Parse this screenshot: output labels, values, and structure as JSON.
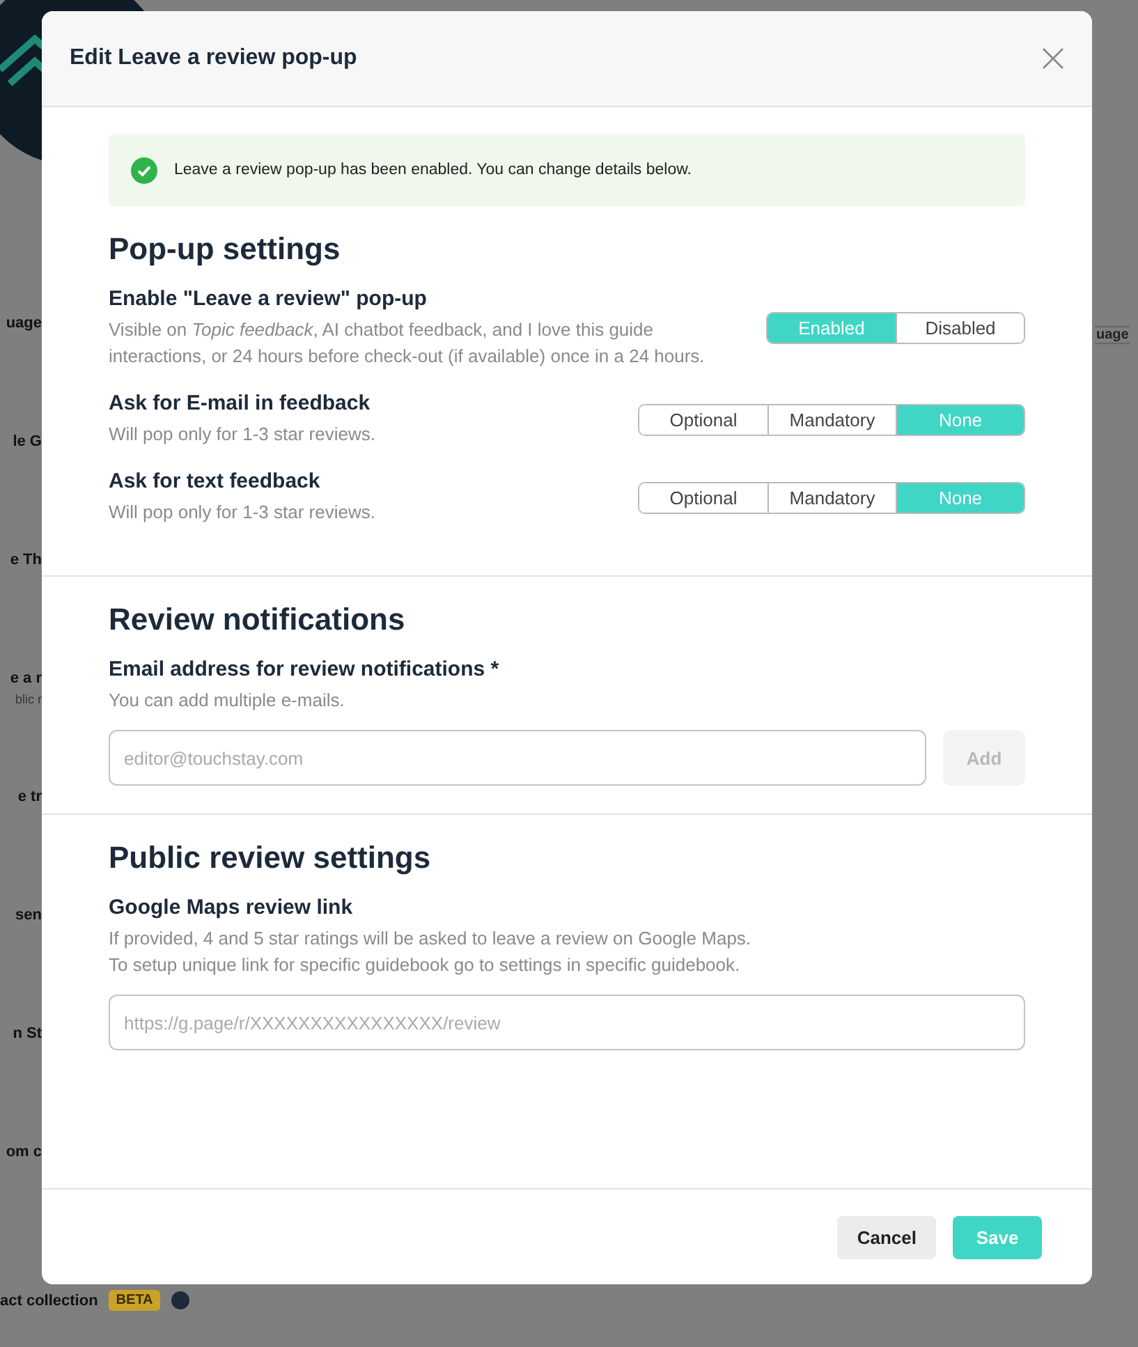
{
  "backdrop": {
    "left_fragments": [
      {
        "text": "uage"
      },
      {
        "text": "le G"
      },
      {
        "text": "e Th"
      },
      {
        "text": "e a r",
        "sub": "blic r"
      },
      {
        "text": "e tr"
      },
      {
        "text": "sen"
      },
      {
        "text": "n St"
      },
      {
        "text": "om c"
      }
    ],
    "right_fragment": "uage",
    "bottom_row": {
      "text": "act collection",
      "badge": "BETA"
    }
  },
  "modal": {
    "title": "Edit Leave a review pop-up",
    "alert": "Leave a review pop-up has been enabled. You can change details below.",
    "sections": [
      {
        "title": "Pop-up settings",
        "settings": [
          {
            "label": "Enable \"Leave a review\" pop-up",
            "help": "Visible on *Topic feedback*, AI chatbot feedback, and I love this guide interactions, or 24 hours before check-out (if available) once in a 24 hours.",
            "options": [
              {
                "label": "Enabled",
                "selected": true
              },
              {
                "label": "Disabled",
                "selected": false
              }
            ]
          },
          {
            "label": "Ask for E-mail in feedback",
            "help": "Will pop only for 1-3 star reviews.",
            "options": [
              {
                "label": "Optional",
                "selected": false
              },
              {
                "label": "Mandatory",
                "selected": false
              },
              {
                "label": "None",
                "selected": true
              }
            ]
          },
          {
            "label": "Ask for text feedback",
            "help": "Will pop only for 1-3 star reviews.",
            "options": [
              {
                "label": "Optional",
                "selected": false
              },
              {
                "label": "Mandatory",
                "selected": false
              },
              {
                "label": "None",
                "selected": true
              }
            ]
          }
        ]
      },
      {
        "title": "Review notifications",
        "field": {
          "label": "Email address for review notifications *",
          "help": [
            "You can add multiple e-mails."
          ],
          "placeholder": "editor@touchstay.com",
          "button": {
            "label": "Add",
            "disabled": true
          }
        }
      },
      {
        "title": "Public review settings",
        "field": {
          "label": "Google Maps review link",
          "help": [
            "If provided, 4 and 5 star ratings will be asked to leave a review on Google Maps.",
            "To setup unique link for specific guidebook go to settings in specific guidebook."
          ],
          "placeholder": "https://g.page/r/XXXXXXXXXXXXXXXX/review"
        }
      }
    ],
    "footer": {
      "cancel": "Cancel",
      "save": "Save"
    }
  }
}
